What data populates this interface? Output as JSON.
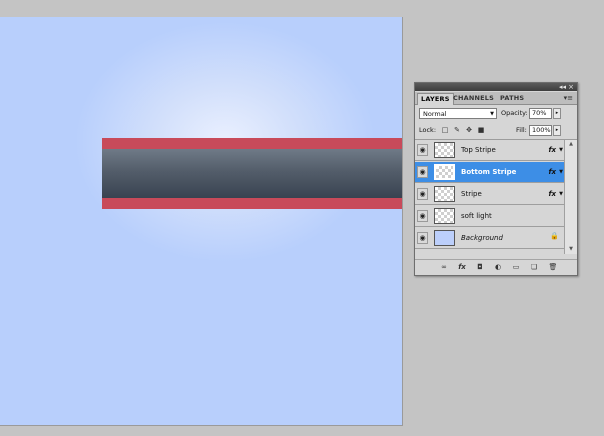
{
  "panel": {
    "tabs": [
      "LAYERS",
      "CHANNELS",
      "PATHS"
    ],
    "blend_mode": "Normal",
    "opacity_label": "Opacity:",
    "opacity_value": "70%",
    "lock_label": "Lock:",
    "fill_label": "Fill:",
    "fill_value": "100%",
    "layers": [
      {
        "name": "Top Stripe",
        "fx": "fx",
        "selected": false,
        "thumb": "transparent-icon"
      },
      {
        "name": "Bottom Stripe",
        "fx": "fx",
        "selected": true,
        "thumb": "transparent-icon"
      },
      {
        "name": "Stripe",
        "fx": "fx",
        "selected": false,
        "thumb": "transparent-icon"
      },
      {
        "name": "soft light",
        "fx": "",
        "selected": false,
        "thumb": "transparent-icon"
      },
      {
        "name": "Background",
        "fx": "",
        "selected": false,
        "thumb": "blue-fill",
        "locked": true
      }
    ]
  },
  "colors": {
    "canvas_blue": "#b8cffc",
    "stripe_red": "#c84a5a",
    "stripe_dark": "#535d6a",
    "selection_blue": "#3d8ee6"
  },
  "icons": {
    "titlebar": [
      "collapse-icon",
      "close-icon"
    ],
    "panel_menu": "panel-menu-icon",
    "locks": [
      "lock-transparent-icon",
      "lock-paint-icon",
      "lock-move-icon",
      "lock-all-icon"
    ],
    "bottom": [
      "link-layers-icon",
      "fx-icon",
      "add-mask-icon",
      "adjustment-layer-icon",
      "new-group-icon",
      "new-layer-icon",
      "delete-layer-icon"
    ]
  }
}
